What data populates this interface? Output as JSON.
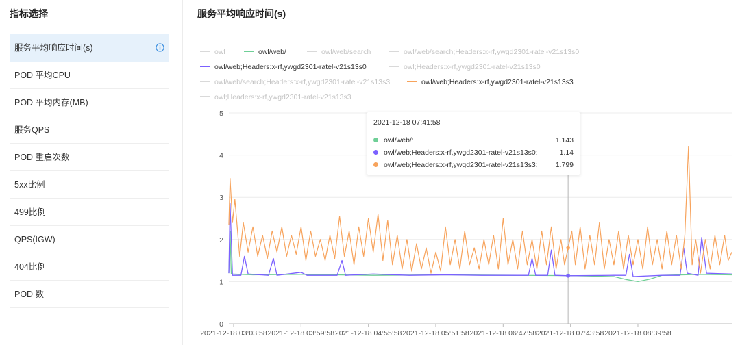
{
  "sidebar": {
    "title": "指标选择",
    "items": [
      {
        "label": "服务平均响应时间(s)",
        "active": true
      },
      {
        "label": "POD 平均CPU"
      },
      {
        "label": "POD 平均内存(MB)"
      },
      {
        "label": "服务QPS"
      },
      {
        "label": "POD 重启次数"
      },
      {
        "label": "5xx比例"
      },
      {
        "label": "499比例"
      },
      {
        "label": "QPS(IGW)"
      },
      {
        "label": "404比例"
      },
      {
        "label": "POD 数"
      }
    ]
  },
  "main": {
    "title": "服务平均响应时间(s)"
  },
  "legend": [
    {
      "name": "owl",
      "active": false,
      "color": "#d9d9d9"
    },
    {
      "name": "owl/web/",
      "active": true,
      "color": "#6fcf97"
    },
    {
      "name": "owl/web/search",
      "active": false,
      "color": "#d9d9d9"
    },
    {
      "name": "owl/web/search;Headers:x-rf,ywgd2301-ratel-v21s13s0",
      "active": false,
      "color": "#d9d9d9"
    },
    {
      "name": "owl/web;Headers:x-rf,ywgd2301-ratel-v21s13s0",
      "active": true,
      "color": "#7b61ff"
    },
    {
      "name": "owl;Headers:x-rf,ywgd2301-ratel-v21s13s0",
      "active": false,
      "color": "#d9d9d9"
    },
    {
      "name": "owl/web/search;Headers:x-rf,ywgd2301-ratel-v21s13s3",
      "active": false,
      "color": "#d9d9d9"
    },
    {
      "name": "owl/web;Headers:x-rf,ywgd2301-ratel-v21s13s3",
      "active": true,
      "color": "#f7a35c"
    },
    {
      "name": "owl;Headers:x-rf,ywgd2301-ratel-v21s13s3",
      "active": false,
      "color": "#d9d9d9"
    }
  ],
  "tooltip": {
    "time": "2021-12-18 07:41:58",
    "rows": [
      {
        "name": "owl/web/:",
        "value": "1.143",
        "color": "#6fcf97"
      },
      {
        "name": "owl/web;Headers:x-rf,ywgd2301-ratel-v21s13s0:",
        "value": "1.14",
        "color": "#7b61ff"
      },
      {
        "name": "owl/web;Headers:x-rf,ywgd2301-ratel-v21s13s3:",
        "value": "1.799",
        "color": "#f7a35c"
      }
    ]
  },
  "chart_data": {
    "type": "line",
    "ylim": [
      0,
      5
    ],
    "yticks": [
      0,
      1,
      2,
      3,
      4,
      5
    ],
    "grid": true,
    "xlim": [
      "2021-12-18 03:00:00",
      "2021-12-18 09:58:00"
    ],
    "xticks": [
      "2021-12-18 03:03:58",
      "2021-12-18 03:59:58",
      "2021-12-18 04:55:58",
      "2021-12-18 05:51:58",
      "2021-12-18 06:47:58",
      "2021-12-18 07:43:58",
      "2021-12-18 08:39:58"
    ],
    "cursor_time": "2021-12-18 07:41:58",
    "series": [
      {
        "name": "owl/web/",
        "color": "#6fcf97",
        "points": [
          [
            "2021-12-18 03:00:00",
            1.2
          ],
          [
            "2021-12-18 03:01:00",
            2.2
          ],
          [
            "2021-12-18 03:02:00",
            1.18
          ],
          [
            "2021-12-18 03:20:00",
            1.16
          ],
          [
            "2021-12-18 04:00:00",
            1.17
          ],
          [
            "2021-12-18 05:00:00",
            1.15
          ],
          [
            "2021-12-18 06:00:00",
            1.16
          ],
          [
            "2021-12-18 07:00:00",
            1.15
          ],
          [
            "2021-12-18 07:41:58",
            1.143
          ],
          [
            "2021-12-18 08:20:00",
            1.12
          ],
          [
            "2021-12-18 08:30:00",
            1.05
          ],
          [
            "2021-12-18 08:40:00",
            1.0
          ],
          [
            "2021-12-18 08:50:00",
            1.06
          ],
          [
            "2021-12-18 09:00:00",
            1.15
          ],
          [
            "2021-12-18 09:30:00",
            1.17
          ],
          [
            "2021-12-18 09:58:00",
            1.16
          ]
        ]
      },
      {
        "name": "owl/web;Headers:x-rf,ywgd2301-ratel-v21s13s0",
        "color": "#7b61ff",
        "points": [
          [
            "2021-12-18 03:00:00",
            1.2
          ],
          [
            "2021-12-18 03:01:00",
            2.85
          ],
          [
            "2021-12-18 03:03:00",
            1.15
          ],
          [
            "2021-12-18 03:10:00",
            1.15
          ],
          [
            "2021-12-18 03:13:00",
            1.6
          ],
          [
            "2021-12-18 03:16:00",
            1.18
          ],
          [
            "2021-12-18 03:33:00",
            1.15
          ],
          [
            "2021-12-18 03:37:00",
            1.55
          ],
          [
            "2021-12-18 03:40:00",
            1.15
          ],
          [
            "2021-12-18 04:00:00",
            1.22
          ],
          [
            "2021-12-18 04:05:00",
            1.15
          ],
          [
            "2021-12-18 04:30:00",
            1.15
          ],
          [
            "2021-12-18 04:34:00",
            1.5
          ],
          [
            "2021-12-18 04:37:00",
            1.15
          ],
          [
            "2021-12-18 05:00:00",
            1.18
          ],
          [
            "2021-12-18 05:30:00",
            1.15
          ],
          [
            "2021-12-18 06:00:00",
            1.16
          ],
          [
            "2021-12-18 06:30:00",
            1.15
          ],
          [
            "2021-12-18 07:00:00",
            1.15
          ],
          [
            "2021-12-18 07:09:00",
            1.15
          ],
          [
            "2021-12-18 07:12:00",
            1.55
          ],
          [
            "2021-12-18 07:15:00",
            1.15
          ],
          [
            "2021-12-18 07:25:00",
            1.15
          ],
          [
            "2021-12-18 07:28:00",
            1.75
          ],
          [
            "2021-12-18 07:31:00",
            1.15
          ],
          [
            "2021-12-18 07:41:58",
            1.14
          ],
          [
            "2021-12-18 08:20:00",
            1.15
          ],
          [
            "2021-12-18 08:30:00",
            1.15
          ],
          [
            "2021-12-18 08:33:00",
            1.65
          ],
          [
            "2021-12-18 08:36:00",
            1.12
          ],
          [
            "2021-12-18 09:00:00",
            1.15
          ],
          [
            "2021-12-18 09:15:00",
            1.15
          ],
          [
            "2021-12-18 09:18:00",
            1.8
          ],
          [
            "2021-12-18 09:21:00",
            1.2
          ],
          [
            "2021-12-18 09:30:00",
            1.15
          ],
          [
            "2021-12-18 09:33:00",
            2.05
          ],
          [
            "2021-12-18 09:37:00",
            1.2
          ],
          [
            "2021-12-18 09:58:00",
            1.18
          ]
        ]
      },
      {
        "name": "owl/web;Headers:x-rf,ywgd2301-ratel-v21s13s3",
        "color": "#f7a35c",
        "points": [
          [
            "2021-12-18 03:00:00",
            2.35
          ],
          [
            "2021-12-18 03:01:00",
            3.45
          ],
          [
            "2021-12-18 03:03:00",
            2.4
          ],
          [
            "2021-12-18 03:05:00",
            2.95
          ],
          [
            "2021-12-18 03:09:00",
            1.6
          ],
          [
            "2021-12-18 03:12:00",
            2.4
          ],
          [
            "2021-12-18 03:16:00",
            1.7
          ],
          [
            "2021-12-18 03:20:00",
            2.3
          ],
          [
            "2021-12-18 03:24:00",
            1.6
          ],
          [
            "2021-12-18 03:28:00",
            2.1
          ],
          [
            "2021-12-18 03:32:00",
            1.55
          ],
          [
            "2021-12-18 03:36:00",
            2.2
          ],
          [
            "2021-12-18 03:40:00",
            1.7
          ],
          [
            "2021-12-18 03:44:00",
            2.3
          ],
          [
            "2021-12-18 03:48:00",
            1.6
          ],
          [
            "2021-12-18 03:52:00",
            2.1
          ],
          [
            "2021-12-18 03:56:00",
            1.65
          ],
          [
            "2021-12-18 04:00:00",
            2.3
          ],
          [
            "2021-12-18 04:04:00",
            1.5
          ],
          [
            "2021-12-18 04:08:00",
            2.2
          ],
          [
            "2021-12-18 04:12:00",
            1.6
          ],
          [
            "2021-12-18 04:16:00",
            2.0
          ],
          [
            "2021-12-18 04:20:00",
            1.5
          ],
          [
            "2021-12-18 04:24:00",
            2.1
          ],
          [
            "2021-12-18 04:28:00",
            1.55
          ],
          [
            "2021-12-18 04:32:00",
            2.55
          ],
          [
            "2021-12-18 04:36:00",
            1.6
          ],
          [
            "2021-12-18 04:40:00",
            2.2
          ],
          [
            "2021-12-18 04:44:00",
            1.4
          ],
          [
            "2021-12-18 04:48:00",
            2.3
          ],
          [
            "2021-12-18 04:52:00",
            1.6
          ],
          [
            "2021-12-18 04:56:00",
            2.5
          ],
          [
            "2021-12-18 05:00:00",
            1.7
          ],
          [
            "2021-12-18 05:04:00",
            2.6
          ],
          [
            "2021-12-18 05:08:00",
            1.5
          ],
          [
            "2021-12-18 05:12:00",
            2.45
          ],
          [
            "2021-12-18 05:16:00",
            1.4
          ],
          [
            "2021-12-18 05:20:00",
            2.1
          ],
          [
            "2021-12-18 05:24:00",
            1.3
          ],
          [
            "2021-12-18 05:28:00",
            2.0
          ],
          [
            "2021-12-18 05:32:00",
            1.25
          ],
          [
            "2021-12-18 05:36:00",
            1.9
          ],
          [
            "2021-12-18 05:40:00",
            1.3
          ],
          [
            "2021-12-18 05:44:00",
            1.8
          ],
          [
            "2021-12-18 05:48:00",
            1.2
          ],
          [
            "2021-12-18 05:52:00",
            1.7
          ],
          [
            "2021-12-18 05:56:00",
            1.25
          ],
          [
            "2021-12-18 06:00:00",
            2.3
          ],
          [
            "2021-12-18 06:04:00",
            1.4
          ],
          [
            "2021-12-18 06:08:00",
            2.0
          ],
          [
            "2021-12-18 06:12:00",
            1.3
          ],
          [
            "2021-12-18 06:16:00",
            2.2
          ],
          [
            "2021-12-18 06:20:00",
            1.4
          ],
          [
            "2021-12-18 06:24:00",
            1.8
          ],
          [
            "2021-12-18 06:28:00",
            1.3
          ],
          [
            "2021-12-18 06:32:00",
            2.0
          ],
          [
            "2021-12-18 06:36:00",
            1.4
          ],
          [
            "2021-12-18 06:40:00",
            2.1
          ],
          [
            "2021-12-18 06:44:00",
            1.3
          ],
          [
            "2021-12-18 06:48:00",
            2.5
          ],
          [
            "2021-12-18 06:52:00",
            1.4
          ],
          [
            "2021-12-18 06:56:00",
            2.0
          ],
          [
            "2021-12-18 07:00:00",
            1.3
          ],
          [
            "2021-12-18 07:04:00",
            2.2
          ],
          [
            "2021-12-18 07:08:00",
            1.4
          ],
          [
            "2021-12-18 07:12:00",
            2.0
          ],
          [
            "2021-12-18 07:16:00",
            1.3
          ],
          [
            "2021-12-18 07:20:00",
            2.2
          ],
          [
            "2021-12-18 07:24:00",
            1.4
          ],
          [
            "2021-12-18 07:28:00",
            2.3
          ],
          [
            "2021-12-18 07:32:00",
            1.3
          ],
          [
            "2021-12-18 07:36:00",
            2.0
          ],
          [
            "2021-12-18 07:39:00",
            1.4
          ],
          [
            "2021-12-18 07:41:58",
            1.799
          ],
          [
            "2021-12-18 07:45:00",
            2.2
          ],
          [
            "2021-12-18 07:48:00",
            1.4
          ],
          [
            "2021-12-18 07:52:00",
            2.3
          ],
          [
            "2021-12-18 07:56:00",
            1.3
          ],
          [
            "2021-12-18 08:00:00",
            2.1
          ],
          [
            "2021-12-18 08:04:00",
            1.4
          ],
          [
            "2021-12-18 08:08:00",
            2.4
          ],
          [
            "2021-12-18 08:12:00",
            1.3
          ],
          [
            "2021-12-18 08:16:00",
            2.0
          ],
          [
            "2021-12-18 08:20:00",
            1.4
          ],
          [
            "2021-12-18 08:24:00",
            2.2
          ],
          [
            "2021-12-18 08:28:00",
            1.3
          ],
          [
            "2021-12-18 08:32:00",
            2.1
          ],
          [
            "2021-12-18 08:36:00",
            1.4
          ],
          [
            "2021-12-18 08:40:00",
            2.0
          ],
          [
            "2021-12-18 08:44:00",
            1.3
          ],
          [
            "2021-12-18 08:48:00",
            2.3
          ],
          [
            "2021-12-18 08:52:00",
            1.4
          ],
          [
            "2021-12-18 08:56:00",
            2.0
          ],
          [
            "2021-12-18 09:00:00",
            1.3
          ],
          [
            "2021-12-18 09:04:00",
            2.2
          ],
          [
            "2021-12-18 09:08:00",
            1.4
          ],
          [
            "2021-12-18 09:12:00",
            2.1
          ],
          [
            "2021-12-18 09:16:00",
            1.3
          ],
          [
            "2021-12-18 09:19:00",
            2.1
          ],
          [
            "2021-12-18 09:22:00",
            4.2
          ],
          [
            "2021-12-18 09:25:00",
            1.4
          ],
          [
            "2021-12-18 09:28:00",
            2.0
          ],
          [
            "2021-12-18 09:32:00",
            1.2
          ],
          [
            "2021-12-18 09:36:00",
            2.0
          ],
          [
            "2021-12-18 09:40:00",
            1.3
          ],
          [
            "2021-12-18 09:44:00",
            2.1
          ],
          [
            "2021-12-18 09:48:00",
            1.4
          ],
          [
            "2021-12-18 09:52:00",
            2.1
          ],
          [
            "2021-12-18 09:55:00",
            1.5
          ],
          [
            "2021-12-18 09:58:00",
            1.7
          ]
        ]
      }
    ]
  }
}
